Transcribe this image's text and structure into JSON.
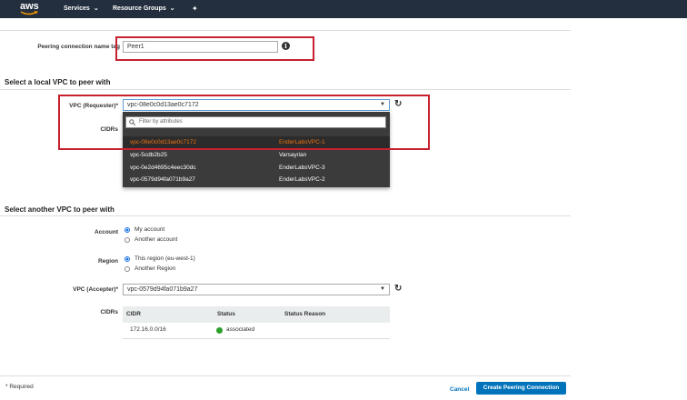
{
  "nav": {
    "logo": "aws",
    "services_label": "Services",
    "resource_groups_label": "Resource Groups",
    "pin_icon": "pin-icon"
  },
  "name_tag": {
    "label": "Peering connection name tag",
    "value": "Peer1",
    "info_icon": "info-icon"
  },
  "local_section": {
    "title": "Select a local VPC to peer with",
    "vpc_label": "VPC (Requester)*",
    "vpc_value": "vpc-08e0c0d13ae0c7172",
    "cidrs_label": "CIDRs",
    "filter_placeholder": "Filter by attributes",
    "options": [
      {
        "id": "vpc-08e0c0d13ae0c7172",
        "name": "EnderLabsVPC-1"
      },
      {
        "id": "vpc-5cdb2b25",
        "name": "Varsayılan"
      },
      {
        "id": "vpc-0e2d4695c4eec30dc",
        "name": "EnderLabsVPC-3"
      },
      {
        "id": "vpc-0579d94fa071b9a27",
        "name": "EnderLabsVPC-2"
      }
    ]
  },
  "another_section": {
    "title": "Select another VPC to peer with",
    "account_label": "Account",
    "account_options": [
      "My account",
      "Another account"
    ],
    "region_label": "Region",
    "region_options": [
      "This region (eu-west-1)",
      "Another Region"
    ],
    "accepter_label": "VPC (Accepter)*",
    "accepter_value": "vpc-0579d94fa071b9a27",
    "cidrs_label": "CIDRs",
    "table": {
      "headers": [
        "CIDR",
        "Status",
        "Status Reason"
      ],
      "rows": [
        {
          "cidr": "172.16.0.0/16",
          "status": "associated",
          "reason": ""
        }
      ]
    }
  },
  "footer": {
    "required_note": "* Required",
    "cancel_label": "Cancel",
    "create_label": "Create Peering Connection"
  },
  "colors": {
    "nav_bg": "#232f3e",
    "highlight_border": "#c7202f",
    "primary": "#0073bb",
    "selected_option": "#ec7211",
    "status_ok": "#2ca02c"
  }
}
